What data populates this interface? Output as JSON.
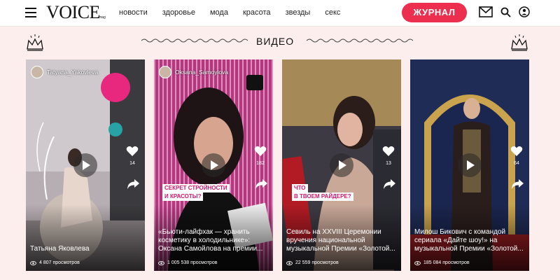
{
  "header": {
    "logo": "VOICE",
    "logo_sub": "mag",
    "nav": [
      "новости",
      "здоровье",
      "мода",
      "красота",
      "звезды",
      "секс"
    ],
    "journal_button": "ЖУРНАЛ",
    "accent_color": "#ec2f4f"
  },
  "section": {
    "title": "ВИДЕО"
  },
  "cards": [
    {
      "author": "Tatyana_Yakovleva",
      "caption": "Татьяна Яковлева",
      "likes": "14",
      "views": "4 807 просмотров",
      "stickers": []
    },
    {
      "author": "Oksana_Samoylova",
      "caption": "«Бьюти-лайфхак — хранить косметику в холодильнике»: Оксана Самойлова на премии...",
      "likes": "182",
      "views": "1 005 538 просмотров",
      "stickers": [
        "Секрет стройности",
        "и красоты?"
      ]
    },
    {
      "author": "",
      "caption": "Севиль на XXVIII Церемонии вручения национальной музыкальной Премии «Золотой...",
      "likes": "13",
      "views": "22 559 просмотров",
      "stickers": [
        "Что",
        "в твоем райдере?"
      ]
    },
    {
      "author": "",
      "caption": "Милош Бикович с командой сериала «Дайте шоу!» на музыкальной Премии «Золотой...",
      "likes": "64",
      "views": "185 084 просмотров",
      "stickers": []
    }
  ]
}
